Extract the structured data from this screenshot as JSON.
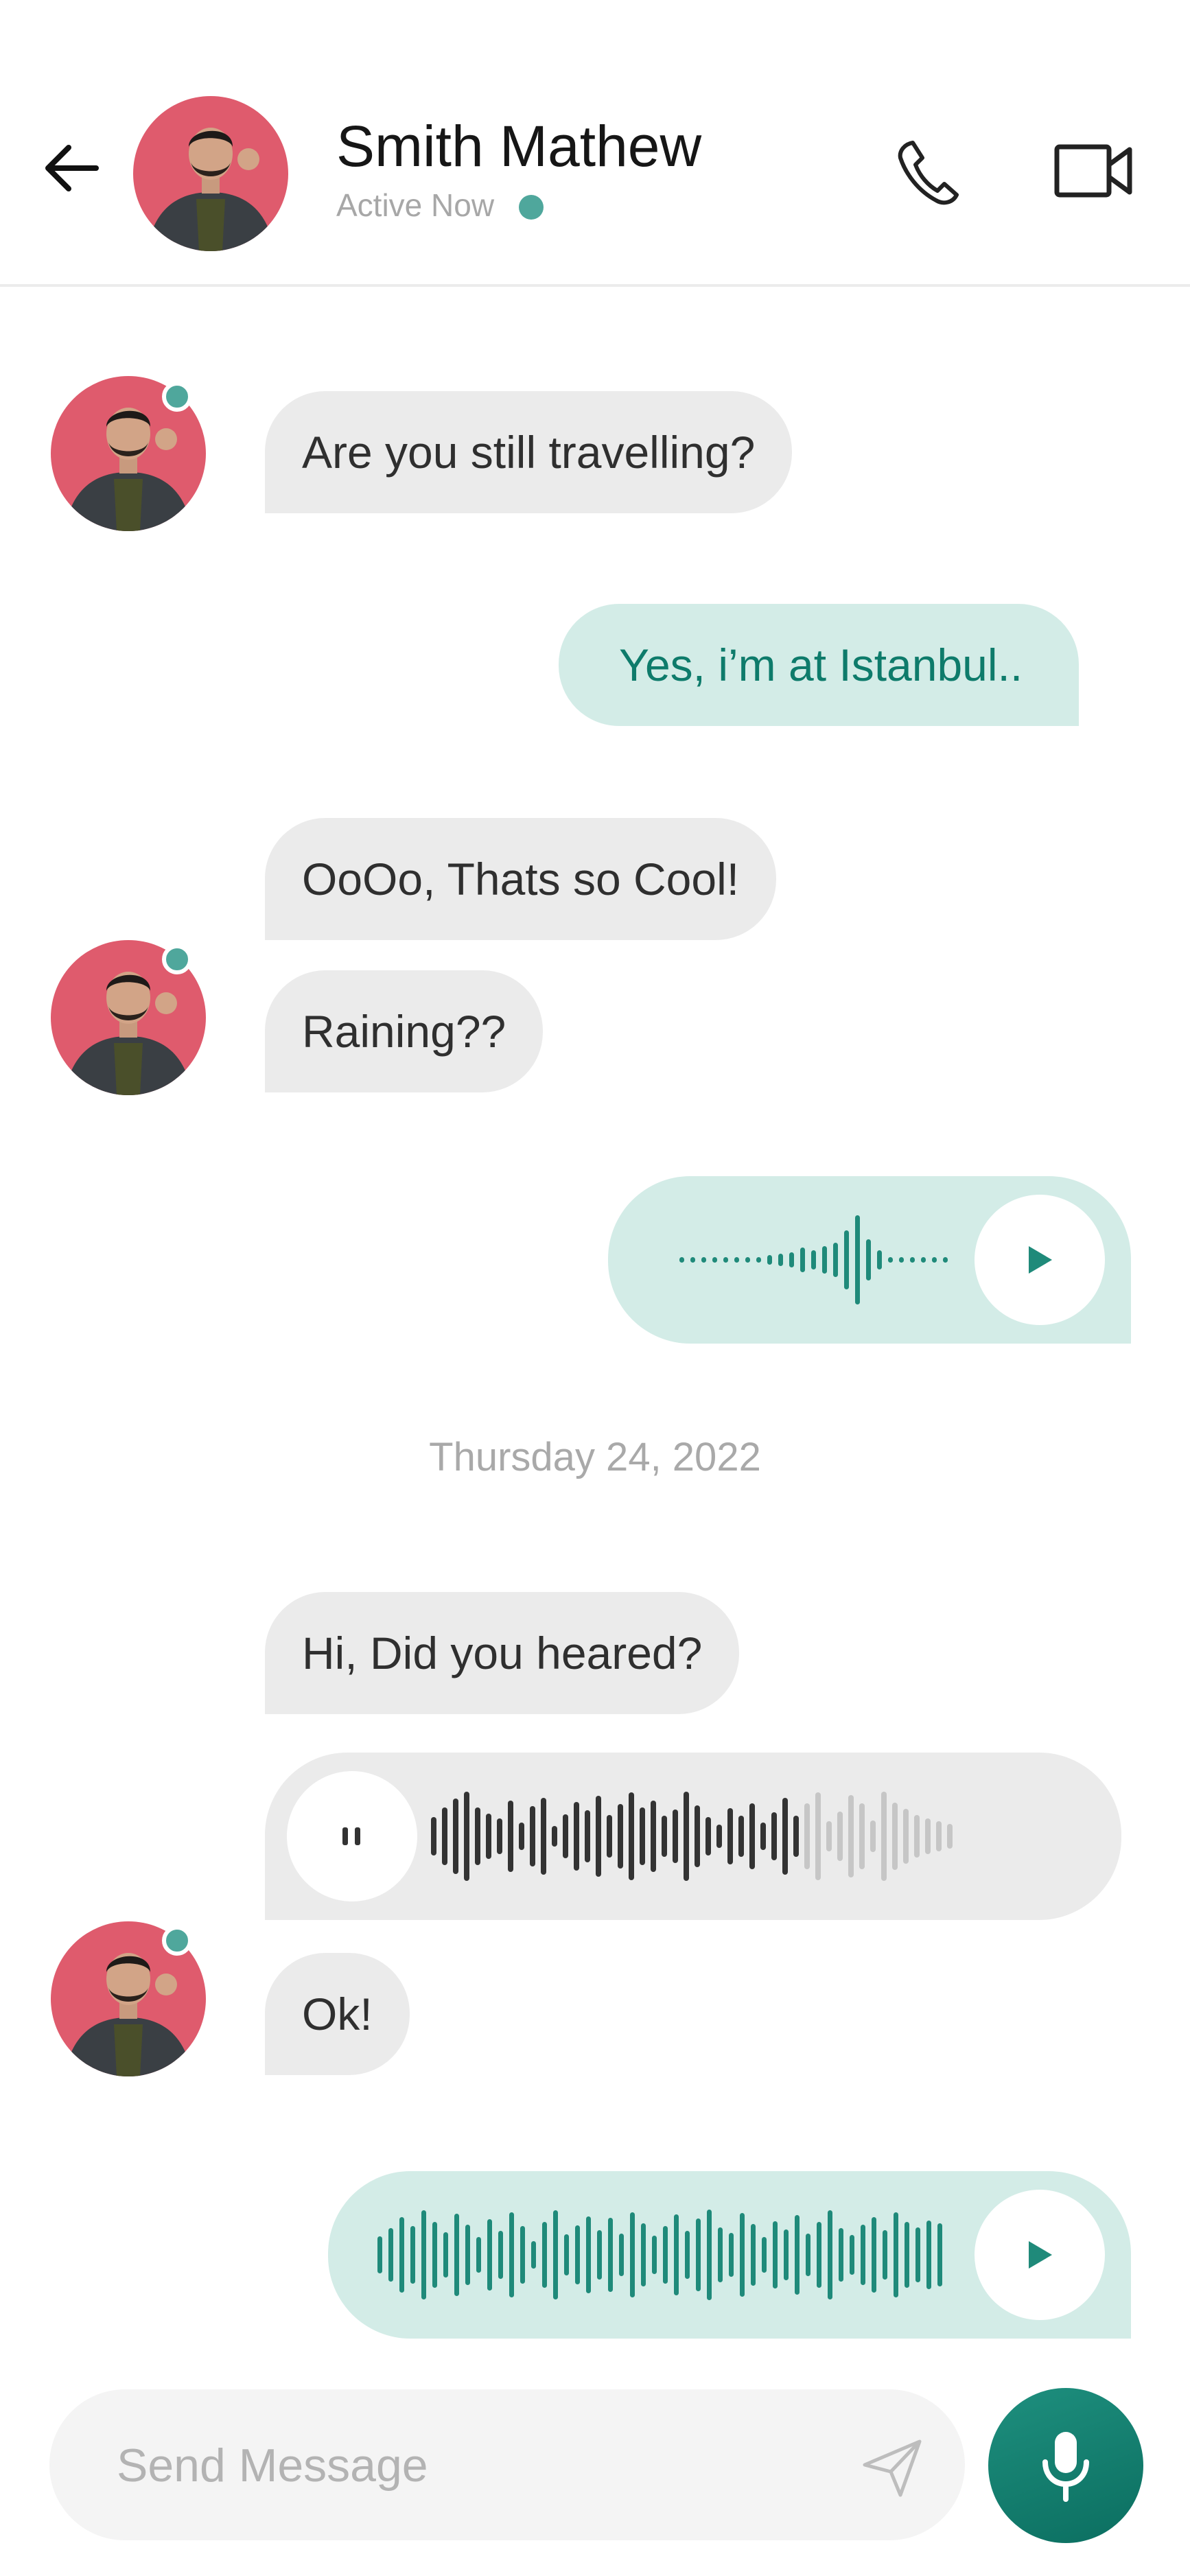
{
  "header": {
    "name": "Smith Mathew",
    "status": "Active Now",
    "status_color": "#4fa79c",
    "back_icon": "arrow-left-icon",
    "call_icon": "phone-icon",
    "video_icon": "video-camera-icon"
  },
  "messages": {
    "m1": "Are you still travelling?",
    "m2": "Yes, i’m at Istanbul..",
    "m3": "OoOo, Thats so Cool!",
    "m4": "Raining??",
    "m5": "Hi, Did you heared?",
    "m6": "Ok!"
  },
  "voice": {
    "sent_1": {
      "state": "paused",
      "icon": "play-icon"
    },
    "received": {
      "state": "playing",
      "icon": "pause-icon",
      "progress": 0.72
    },
    "sent_2": {
      "state": "paused",
      "icon": "play-icon"
    }
  },
  "date_separator": "Thursday 24, 2022",
  "composer": {
    "placeholder": "Send Message",
    "send_icon": "send-icon",
    "mic_icon": "microphone-icon"
  },
  "colors": {
    "accent": "#0e7b6b",
    "outgoing_bubble": "#d3ece7",
    "incoming_bubble": "#ebebeb",
    "avatar_bg": "#df5b6d"
  }
}
